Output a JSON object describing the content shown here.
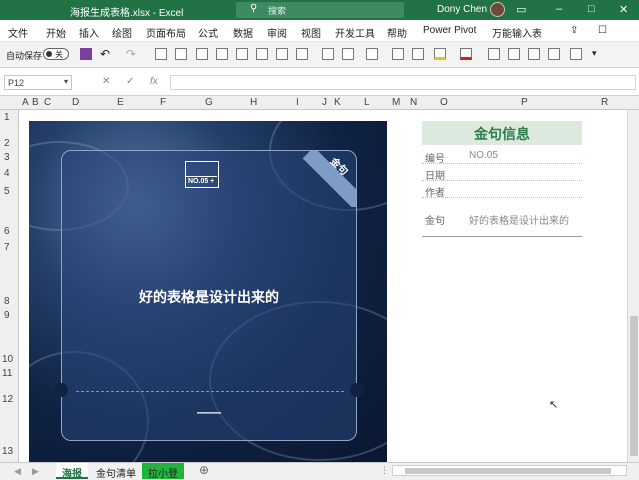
{
  "window": {
    "filename": "海报生成表格.xlsx - Excel",
    "search_placeholder": "搜索",
    "user": "Dony Chen",
    "min": "–",
    "max": "□",
    "close": "✕"
  },
  "menu": [
    "文件",
    "开始",
    "插入",
    "绘图",
    "页面布局",
    "公式",
    "数据",
    "审阅",
    "视图",
    "开发工具",
    "帮助",
    "Power Pivot",
    "万能输入表"
  ],
  "toolbar": {
    "autosave_label": "自动保存",
    "autosave_state": "关"
  },
  "formula": {
    "namebox": "P12",
    "cancel": "✕",
    "confirm": "✓",
    "fx": "fx",
    "value": ""
  },
  "columns": [
    "A",
    "B",
    "C",
    "D",
    "E",
    "F",
    "G",
    "H",
    "I",
    "J",
    "K",
    "L",
    "M",
    "N",
    "O",
    "P",
    "R"
  ],
  "rows": [
    "1",
    "2",
    "3",
    "4",
    "5",
    "6",
    "7",
    "8",
    "9",
    "10",
    "11",
    "12",
    "13"
  ],
  "poster": {
    "badge": "NO.05 +",
    "ribbon": "金句",
    "quote": "好的表格是设计出来的",
    "author": "——"
  },
  "info": {
    "title": "金句信息",
    "fields": [
      {
        "label": "编号",
        "value": "NO.05"
      },
      {
        "label": "日期",
        "value": ""
      },
      {
        "label": "作者",
        "value": ""
      },
      {
        "label": "金句",
        "value": "好的表格是设计出来的"
      }
    ]
  },
  "sheets": [
    "海报",
    "金句清单",
    "拉小登"
  ],
  "colors": {
    "excel_green": "#217346",
    "info_bg": "#dbe9df",
    "info_title": "#2e7d4a",
    "poster_bg": "#0f2242",
    "active_tab_green": "#22b33c"
  }
}
